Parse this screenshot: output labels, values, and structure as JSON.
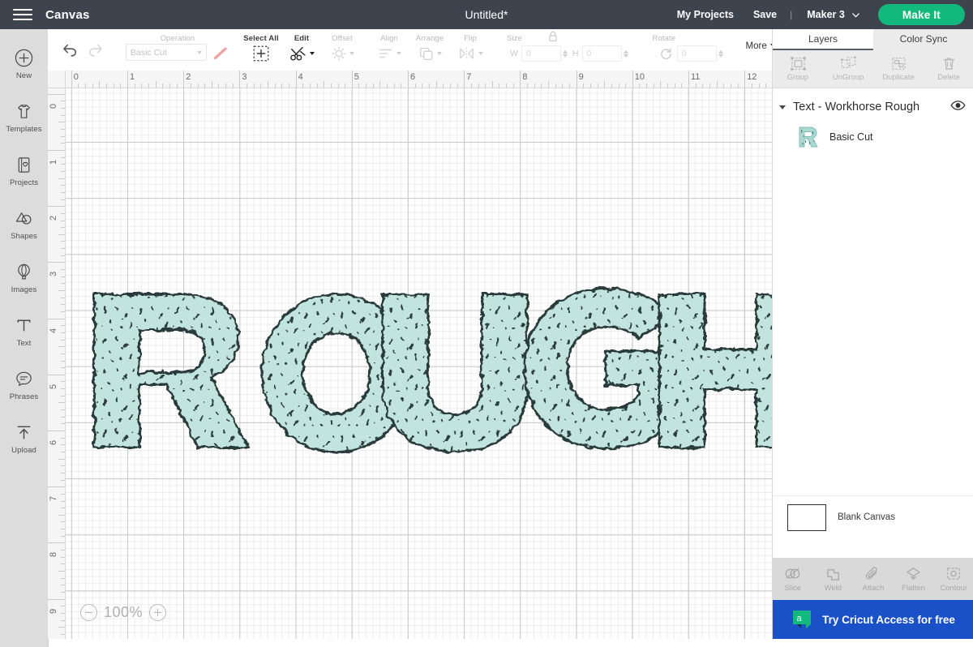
{
  "topbar": {
    "menu_icon": "hamburger-icon",
    "canvas_label": "Canvas",
    "document_title": "Untitled*",
    "my_projects": "My Projects",
    "save": "Save",
    "separator": "|",
    "machine": "Maker 3",
    "machine_chevron": "chevron-down-icon",
    "make_it": "Make It",
    "accent_green": "#13b97c",
    "bar_color": "#3d444d"
  },
  "left_rail": {
    "items": [
      {
        "label": "New",
        "icon": "plus-circle-icon"
      },
      {
        "label": "Templates",
        "icon": "tshirt-icon"
      },
      {
        "label": "Projects",
        "icon": "card-heart-icon"
      },
      {
        "label": "Shapes",
        "icon": "shapes-icon"
      },
      {
        "label": "Images",
        "icon": "hot-air-balloon-icon"
      },
      {
        "label": "Text",
        "icon": "text-t-icon"
      },
      {
        "label": "Phrases",
        "icon": "speech-bubble-icon"
      },
      {
        "label": "Upload",
        "icon": "upload-arrow-icon"
      }
    ]
  },
  "toolbar": {
    "undo": "undo-icon",
    "redo": "redo-icon",
    "operation_label": "Operation",
    "operation_value": "Basic Cut",
    "operation_swatch": "#f0a0a0",
    "select_all_label": "Select All",
    "select_all_icon": "marquee-plus-icon",
    "edit_label": "Edit",
    "edit_icon": "scissors-icon",
    "offset_label": "Offset",
    "offset_icon": "offset-sun-icon",
    "align_label": "Align",
    "align_icon": "align-left-icon",
    "arrange_label": "Arrange",
    "arrange_icon": "layers-icon",
    "flip_label": "Flip",
    "flip_icon": "flip-horizontal-icon",
    "size_label": "Size",
    "lock_icon": "lock-icon",
    "width_label": "W",
    "width_value": "0",
    "height_label": "H",
    "height_value": "0",
    "rotate_label": "Rotate",
    "rotate_icon": "rotate-icon",
    "rotate_value": "0",
    "more_label": "More"
  },
  "canvas": {
    "zoom_level": "100%",
    "zoom_out_icon": "minus-circle-icon",
    "zoom_in_icon": "plus-circle-icon",
    "ruler_h_labels": [
      "0",
      "1",
      "2",
      "3",
      "4",
      "5",
      "6",
      "7",
      "8",
      "9",
      "10",
      "11",
      "12"
    ],
    "ruler_v_labels": [
      "0",
      "1",
      "2",
      "3",
      "4",
      "5",
      "6",
      "7",
      "8",
      "9"
    ],
    "grid_units": "inches",
    "artwork_text": "ROUGH",
    "artwork_fill": "#c2e4df",
    "artwork_stroke": "#2c3a3a"
  },
  "right_panel": {
    "tabs": [
      {
        "label": "Layers",
        "active": true
      },
      {
        "label": "Color Sync",
        "active": false
      }
    ],
    "actions": [
      {
        "label": "Group",
        "icon": "group-icon"
      },
      {
        "label": "UnGroup",
        "icon": "ungroup-icon"
      },
      {
        "label": "Duplicate",
        "icon": "duplicate-icon"
      },
      {
        "label": "Delete",
        "icon": "trash-icon"
      }
    ],
    "layer": {
      "title": "Text - Workhorse Rough",
      "expand_icon": "triangle-down-icon",
      "visibility_icon": "eye-icon",
      "sublayer_label": "Basic Cut",
      "sublayer_thumb": "letter-r-thumbnail"
    },
    "canvas_row": {
      "label": "Blank Canvas",
      "swatch_color": "#ffffff"
    },
    "bottom_actions": [
      {
        "label": "Slice",
        "icon": "slice-icon"
      },
      {
        "label": "Weld",
        "icon": "weld-icon"
      },
      {
        "label": "Attach",
        "icon": "paperclip-icon"
      },
      {
        "label": "Flatten",
        "icon": "flatten-icon"
      },
      {
        "label": "Contour",
        "icon": "contour-icon"
      }
    ],
    "access_banner": {
      "label": "Try Cricut Access for free",
      "logo": "cricut-access-a-icon",
      "bg_color": "#1a50c8",
      "logo_color": "#13b97c"
    }
  }
}
